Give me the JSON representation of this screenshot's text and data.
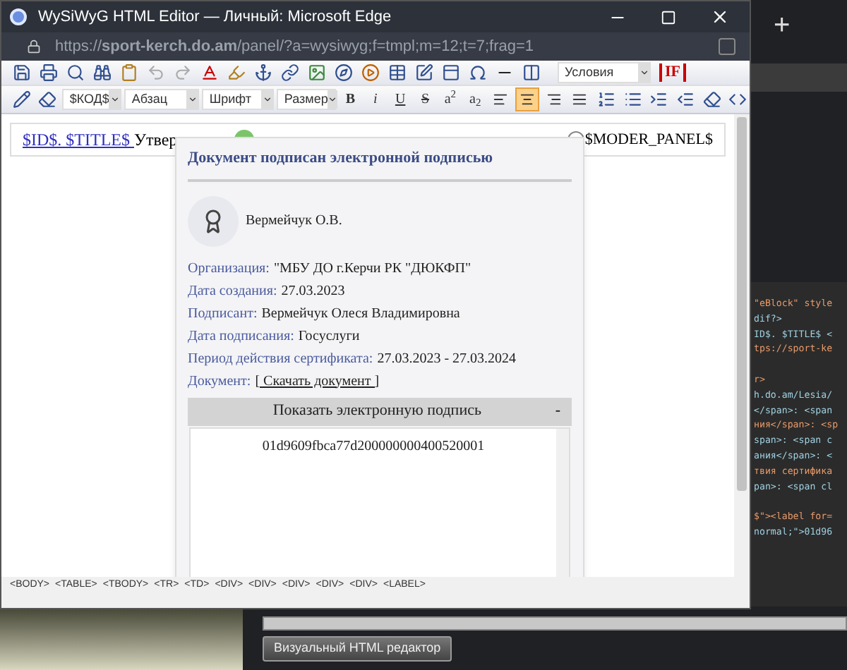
{
  "window": {
    "title": "WySiWyG HTML Editor — Личный: Microsoft Edge"
  },
  "address_bar": {
    "url": "https://**sport-kerch.do.am**/panel/?a=wysiwyg;f=tmpl;m=12;t=7;frag=1"
  },
  "toolbar_row_1": {
    "conditions_select": "Условия",
    "if_button": "IF"
  },
  "toolbar_row_2": {
    "selects": [
      "$КОД$",
      "Абзац",
      "Шрифт",
      "Размер"
    ],
    "format_buttons": [
      "B",
      "i",
      "U",
      "S",
      "a$^{2}$",
      "a$_{2}$"
    ],
    "align_buttons": [
      {
        "kind": "left",
        "selected": false
      },
      {
        "kind": "center",
        "selected": true
      },
      {
        "kind": "right",
        "selected": false
      },
      {
        "kind": "justify",
        "selected": false
      }
    ]
  },
  "editor": {
    "title_link": "$ID$. $TITLE$ ",
    "title_text": "Утвер",
    "moder_panel": "$MODER_PANEL$"
  },
  "signature_popup": {
    "title": "Документ подписан электронной подписью",
    "signer_short": "Вермейчук О.В.",
    "fields": [
      {
        "label": "Организация:",
        "value": "\"МБУ ДО г.Керчи РК \"ДЮКФП\""
      },
      {
        "label": "Дата создания:",
        "value": "27.03.2023"
      },
      {
        "label": "Подписант:",
        "value": "Вермейчук Олеся Владимировна"
      },
      {
        "label": "Дата подписания:",
        "value": "Госуслуги"
      },
      {
        "label": "Период действия сертификата:",
        "value": "27.03.2023 - 27.03.2024"
      }
    ],
    "document_label": "Документ:",
    "document_link": "[ Скачать документ ]",
    "toggle": {
      "label": "Показать электронную подпись",
      "sign": "-",
      "expanded": true
    },
    "signature_id": "01d9609fbca77d200000000400520001"
  },
  "path_bar": [
    "<BODY>",
    "<TABLE>",
    "<TBODY>",
    "<TR>",
    "<TD>",
    "<DIV>",
    "<DIV>",
    "<DIV>",
    "<DIV>",
    "<DIV>",
    "<LABEL>"
  ],
  "background_code": [
    [
      "\"eBlock\" style",
      "dif?>",
      "ID$. $TITLE$ <",
      "tps://sport-ke"
    ],
    [
      "r>",
      "h.do.am/Lesia/",
      "</span>: <span",
      "ния</span>: <sp",
      "span>: <span c",
      "ания</span>: <",
      "твия сертифика",
      "pan>: <span cl"
    ],
    [
      "$\"><label for=",
      "normal;\">01d96"
    ]
  ],
  "background_button": "Визуальный HTML редактор",
  "browser_tab_add": "+"
}
